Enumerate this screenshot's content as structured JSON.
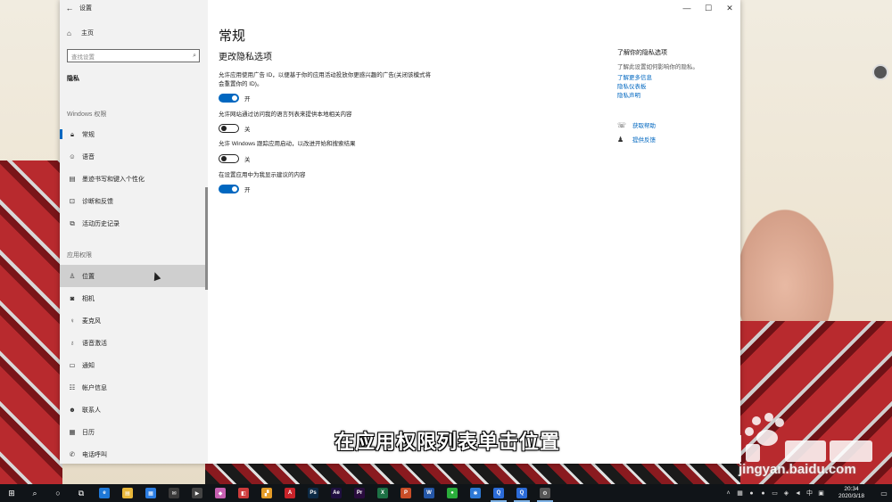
{
  "window": {
    "title": "设置",
    "controls": {
      "minimize": "—",
      "maximize": "☐",
      "close": "✕"
    }
  },
  "sidebar": {
    "home_label": "主页",
    "search_placeholder": "查找设置",
    "section_label": "隐私",
    "windows_group_label": "Windows 权限",
    "windows_items": [
      {
        "label": "常规",
        "icon": "lock-icon",
        "selected": true
      },
      {
        "label": "语音",
        "icon": "speech-icon"
      },
      {
        "label": "墨迹书写和键入个性化",
        "icon": "pen-icon"
      },
      {
        "label": "诊断和反馈",
        "icon": "feedback-icon"
      },
      {
        "label": "活动历史记录",
        "icon": "history-icon"
      }
    ],
    "app_group_label": "应用权限",
    "app_items": [
      {
        "label": "位置",
        "icon": "location-icon",
        "hovered": true
      },
      {
        "label": "相机",
        "icon": "camera-icon"
      },
      {
        "label": "麦克风",
        "icon": "microphone-icon"
      },
      {
        "label": "语音激活",
        "icon": "voice-activation-icon"
      },
      {
        "label": "通知",
        "icon": "notification-icon"
      },
      {
        "label": "帐户信息",
        "icon": "account-icon"
      },
      {
        "label": "联系人",
        "icon": "contacts-icon"
      },
      {
        "label": "日历",
        "icon": "calendar-icon"
      },
      {
        "label": "电话呼叫",
        "icon": "phone-icon"
      }
    ]
  },
  "main": {
    "title": "常规",
    "subtitle": "更改隐私选项",
    "settings": [
      {
        "desc": "允许应用使用广告 ID，以便基于你的应用活动投放你更感兴趣的广告(关闭该模式将会重置你的 ID)。",
        "state": "开",
        "on": true
      },
      {
        "desc": "允许网站通过访问我的语言列表来提供本地相关内容",
        "state": "关",
        "on": false
      },
      {
        "desc": "允许 Windows 跟踪应用启动，以改进开始和搜索结果",
        "state": "关",
        "on": false
      },
      {
        "desc": "在设置应用中为我显示建议的内容",
        "state": "开",
        "on": true
      }
    ]
  },
  "right_panel": {
    "title": "了解你的隐私选项",
    "desc": "了解此设置如何影响你的隐私。",
    "links": [
      "了解更多信息",
      "隐私仪表板",
      "隐私声明"
    ],
    "help_label": "获取帮助",
    "feedback_label": "提供反馈"
  },
  "overlay": {
    "caption": "在应用权限列表单击位置",
    "watermark_text": "jingyan.baidu.com"
  },
  "taskbar": {
    "time": "20:34",
    "date": "2020/3/18",
    "apps": [
      {
        "name": "edge-icon",
        "glyph": "e",
        "color": "#1e78d7"
      },
      {
        "name": "explorer-icon",
        "glyph": "▤",
        "color": "#e8b73a"
      },
      {
        "name": "store-icon",
        "glyph": "▦",
        "color": "#2b7de1"
      },
      {
        "name": "mail-icon",
        "glyph": "✉",
        "color": "#3a3a3a"
      },
      {
        "name": "media-icon",
        "glyph": "▶",
        "color": "#444"
      },
      {
        "name": "photos-icon",
        "glyph": "◆",
        "color": "#c65fb0"
      },
      {
        "name": "palette-icon",
        "glyph": "◧",
        "color": "#cc3b3b"
      },
      {
        "name": "grid-app-icon",
        "glyph": "▞",
        "color": "#e49b27"
      },
      {
        "name": "pdf-icon",
        "glyph": "A",
        "color": "#c8232a"
      },
      {
        "name": "photoshop-icon",
        "glyph": "Ps",
        "color": "#0d2a45"
      },
      {
        "name": "after-effects-icon",
        "glyph": "Ae",
        "color": "#1f0f40"
      },
      {
        "name": "premiere-icon",
        "glyph": "Pr",
        "color": "#2a0c3e"
      },
      {
        "name": "excel-icon",
        "glyph": "X",
        "color": "#1d7145"
      },
      {
        "name": "powerpoint-icon",
        "glyph": "P",
        "color": "#c94d27"
      },
      {
        "name": "word-icon",
        "glyph": "W",
        "color": "#2456a6"
      },
      {
        "name": "wechat-icon",
        "glyph": "●",
        "color": "#2aad3b"
      },
      {
        "name": "star-app-icon",
        "glyph": "✱",
        "color": "#2d79d6"
      },
      {
        "name": "browser-q-icon",
        "glyph": "Q",
        "color": "#2b6bd8"
      },
      {
        "name": "browser-q2-icon",
        "glyph": "Q",
        "color": "#2b6bd8"
      },
      {
        "name": "settings-icon",
        "glyph": "⚙",
        "color": "#555"
      }
    ]
  }
}
